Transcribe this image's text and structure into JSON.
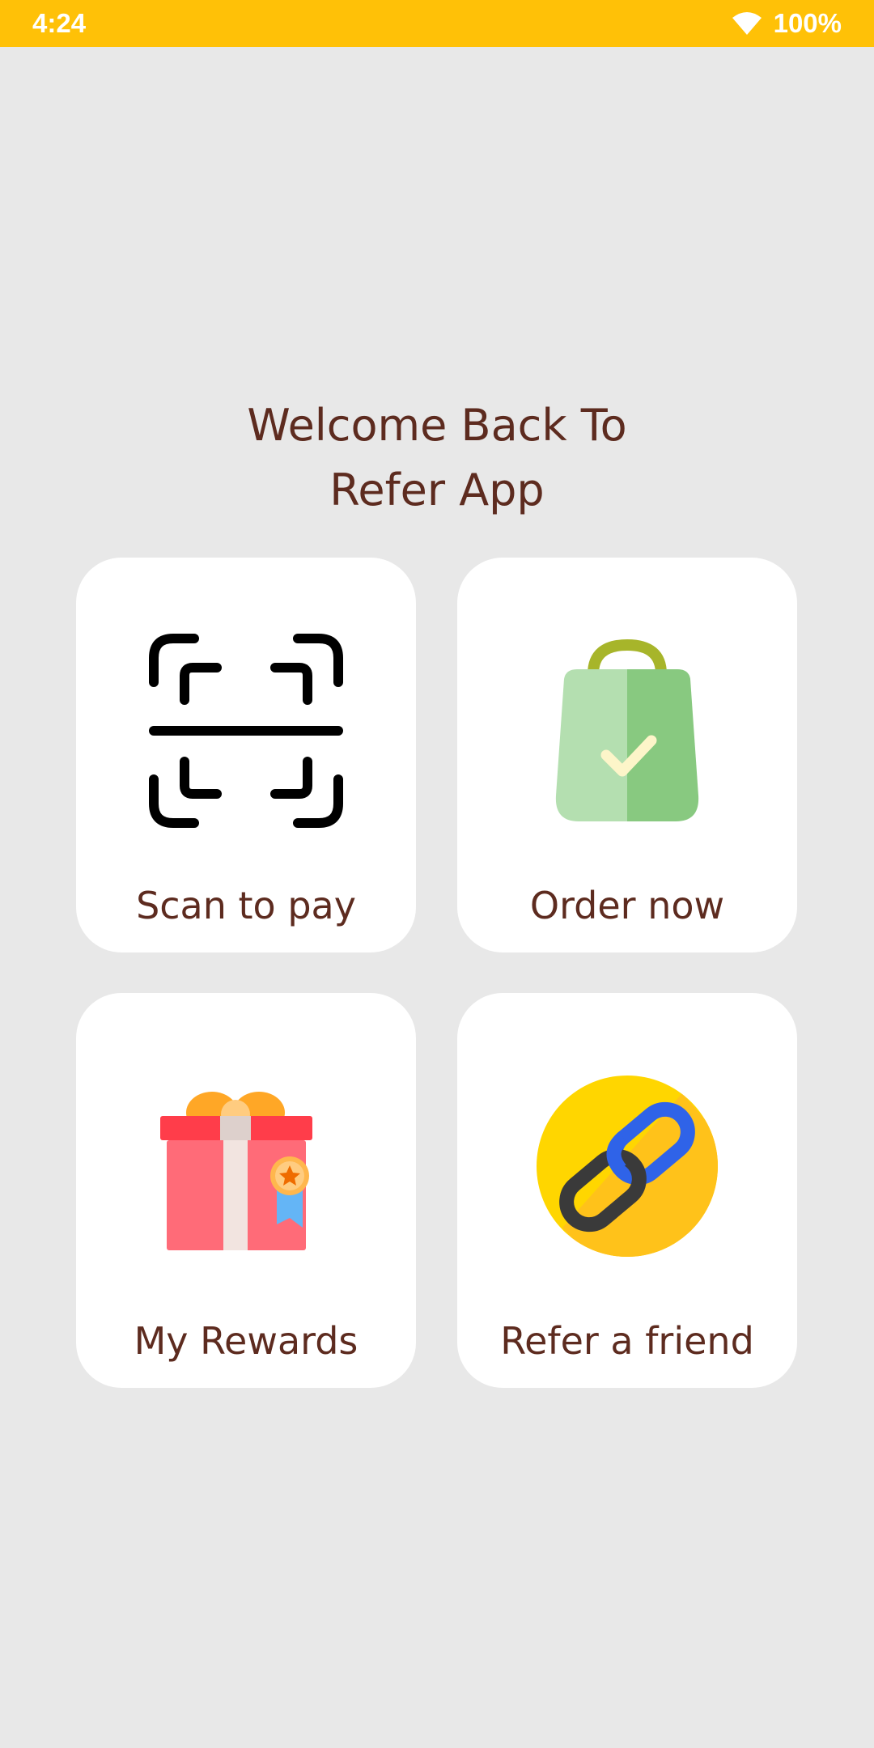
{
  "status_bar": {
    "time": "4:24",
    "battery": "100%",
    "color": "#ffc107"
  },
  "title": {
    "line1": "Welcome Back To",
    "line2": "Refer App"
  },
  "cards": [
    {
      "label": "Scan to pay",
      "icon": "scan-icon"
    },
    {
      "label": "Order now",
      "icon": "shopping-bag-icon"
    },
    {
      "label": "My Rewards",
      "icon": "gift-icon"
    },
    {
      "label": "Refer a friend",
      "icon": "link-icon"
    }
  ],
  "colors": {
    "background": "#e8e8e8",
    "card": "#ffffff",
    "text": "#5d2b1f",
    "accent": "#ffc107"
  }
}
